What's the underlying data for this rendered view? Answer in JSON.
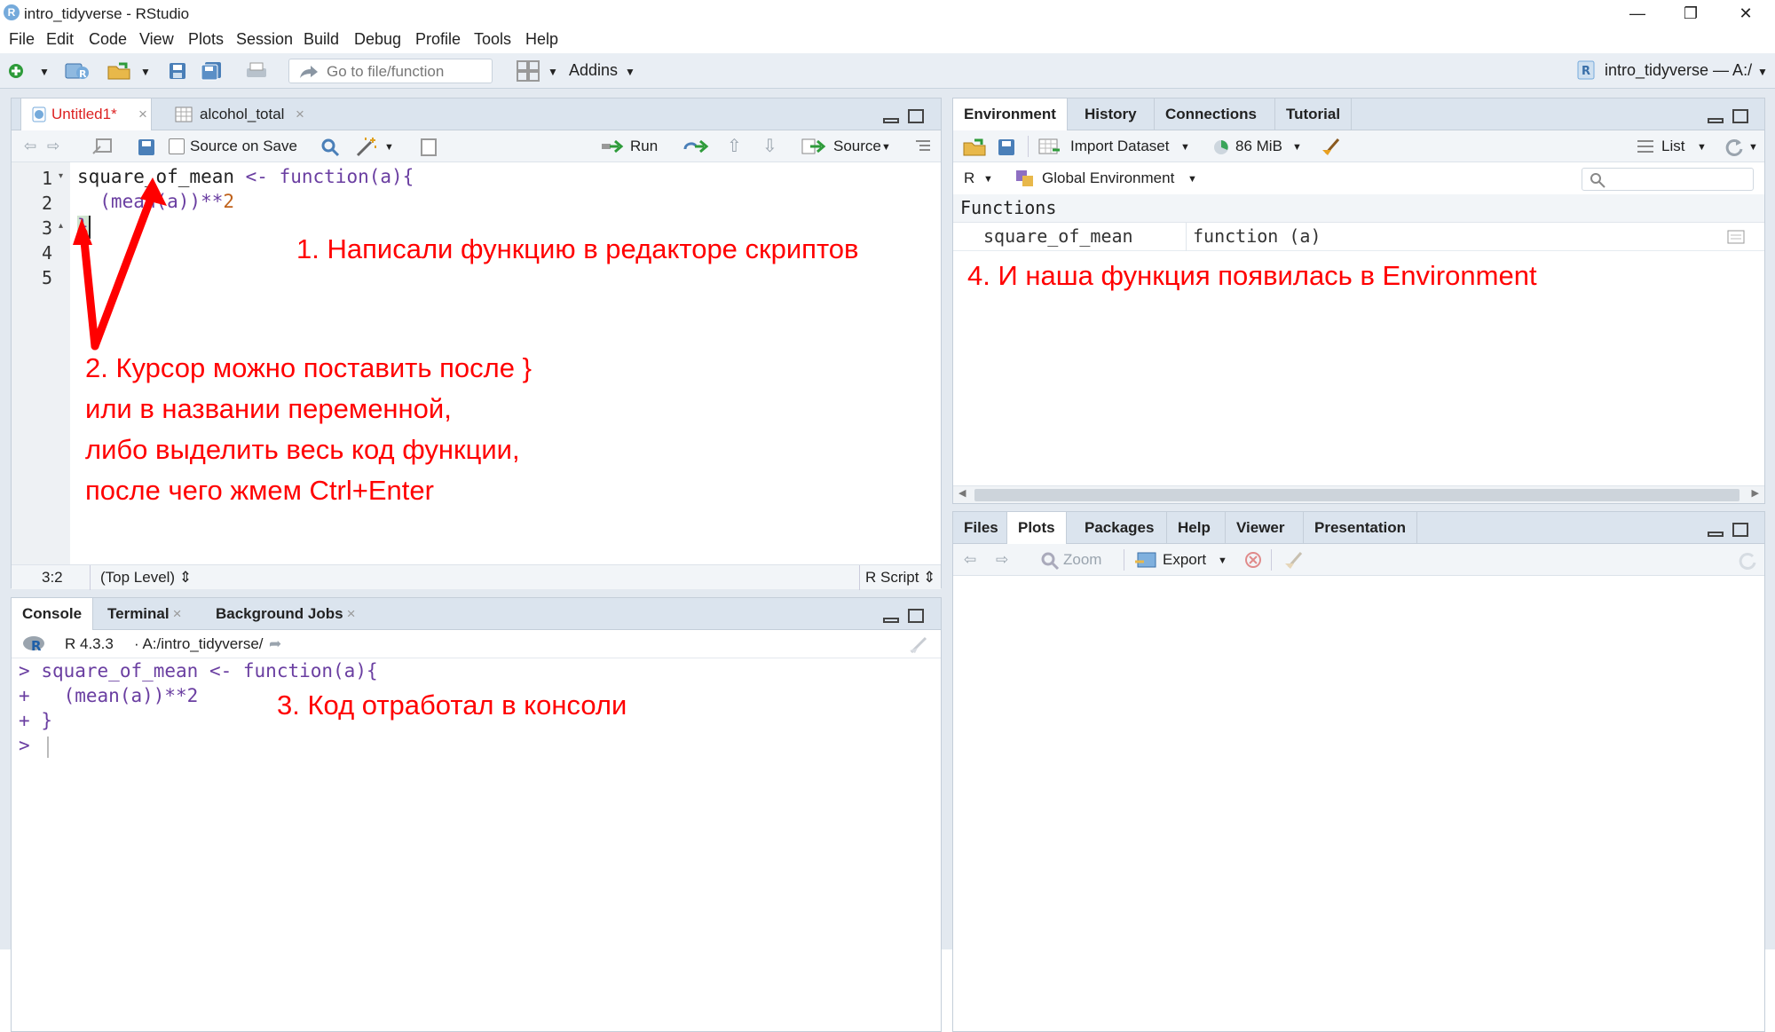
{
  "window": {
    "title": "intro_tidyverse - RStudio",
    "logo": "R"
  },
  "menu": [
    "File",
    "Edit",
    "Code",
    "View",
    "Plots",
    "Session",
    "Build",
    "Debug",
    "Profile",
    "Tools",
    "Help"
  ],
  "toolbar": {
    "goto_placeholder": "Go to file/function",
    "addins": "Addins",
    "project": "intro_tidyverse — A:/"
  },
  "editor": {
    "tabs": [
      {
        "label": "Untitled1*",
        "close": "×"
      },
      {
        "label": "alcohol_total",
        "close": "×"
      }
    ],
    "source_on_save": "Source on Save",
    "run": "Run",
    "source": "Source",
    "lines": [
      "1",
      "2",
      "3",
      "4",
      "5"
    ],
    "code": {
      "l1_name": "square_of_mean",
      "l1_assign": " <- ",
      "l1_fn": "function(a){",
      "l2_a": "  (mean(a))",
      "l2_op": "**",
      "l2_num": "2",
      "l3": "}"
    },
    "status": {
      "pos": "3:2",
      "level": "(Top Level) ⇕",
      "type": "R Script ⇕"
    }
  },
  "console": {
    "tabs": [
      {
        "label": "Console"
      },
      {
        "label": "Terminal",
        "close": "×"
      },
      {
        "label": "Background Jobs",
        "close": "×"
      }
    ],
    "version": "R 4.3.3",
    "path": "· A:/intro_tidyverse/",
    "lines": [
      {
        "prompt": ">",
        "text": "square_of_mean <- function(a){"
      },
      {
        "prompt": "+",
        "text": "  (mean(a))**2"
      },
      {
        "prompt": "+",
        "text": "}"
      },
      {
        "prompt": ">",
        "text": ""
      }
    ]
  },
  "environment": {
    "tabs": [
      "Environment",
      "History",
      "Connections",
      "Tutorial"
    ],
    "import_dataset": "Import Dataset",
    "memory": "86 MiB",
    "list": "List",
    "lang": "R",
    "scope": "Global Environment",
    "section": "Functions",
    "rows": [
      {
        "name": "square_of_mean",
        "value": "function (a)"
      }
    ]
  },
  "files": {
    "tabs": [
      "Files",
      "Plots",
      "Packages",
      "Help",
      "Viewer",
      "Presentation"
    ],
    "zoom": "Zoom",
    "export": "Export"
  },
  "annotations": {
    "a1": "1.   Написали функцию в редакторе скриптов",
    "a2": [
      "2. Курсор можно поставить после }",
      "или в названии переменной,",
      "либо выделить весь код функции,",
      "после чего жмем Ctrl+Enter"
    ],
    "a3": "3. Код отработал в консоли",
    "a4": "4. И наша функция появилась в Environment"
  },
  "colors": {
    "annotation": "#ff0000",
    "code_purple": "#6a3ea1",
    "code_number": "#c0621b",
    "pane_header": "#dbe4ee",
    "toolbar": "#e9eef4"
  }
}
